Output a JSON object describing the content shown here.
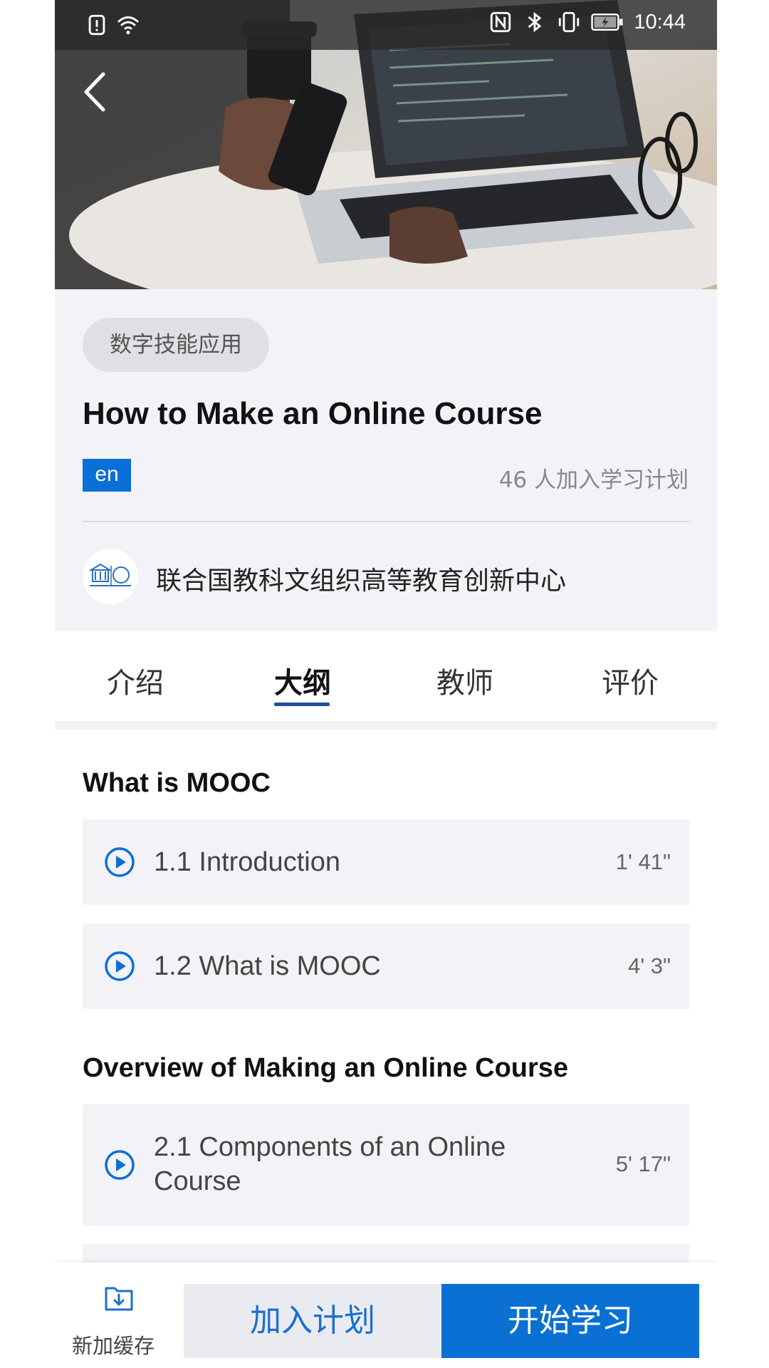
{
  "status_bar": {
    "time": "10:44",
    "icons": [
      "sim-alert-icon",
      "wifi-icon",
      "nfc-icon",
      "bluetooth-icon",
      "vibrate-icon",
      "battery-charging-icon"
    ]
  },
  "course": {
    "category": "数字技能应用",
    "title": "How to Make an Online Course",
    "language": "en",
    "enrolled": "46 人加入学习计划",
    "organization": "联合国教科文组织高等教育创新中心"
  },
  "tabs": [
    {
      "label": "介绍",
      "active": false
    },
    {
      "label": "大纲",
      "active": true
    },
    {
      "label": "教师",
      "active": false
    },
    {
      "label": "评价",
      "active": false
    }
  ],
  "outline": [
    {
      "section": "What is MOOC",
      "lessons": [
        {
          "title": "1.1 Introduction",
          "duration": "1' 41\""
        },
        {
          "title": "1.2 What is MOOC",
          "duration": "4' 3\""
        }
      ]
    },
    {
      "section": "Overview of Making an Online Course",
      "lessons": [
        {
          "title": "2.1 Components of an Online Course",
          "duration": "5' 17\""
        }
      ]
    }
  ],
  "bottom_bar": {
    "cache_label": "新加缓存",
    "join_label": "加入计划",
    "start_label": "开始学习"
  },
  "colors": {
    "accent": "#0a70d4",
    "tab_underline": "#1d4fa0",
    "info_bg": "#f3f2f7"
  }
}
